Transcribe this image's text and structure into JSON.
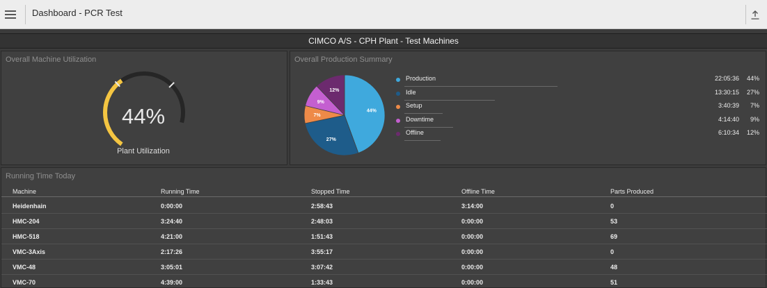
{
  "header": {
    "title": "Dashboard - PCR Test",
    "menu_icon": "hamburger-menu-icon",
    "upload_icon": "upload-icon"
  },
  "banner": {
    "title": "CIMCO A/S - CPH Plant - Test Machines"
  },
  "utilization": {
    "panel_title": "Overall Machine Utilization",
    "value_text": "44%",
    "value": 0.44,
    "label": "Plant Utilization",
    "colors": {
      "fill": "#f4c542",
      "track": "#262626"
    }
  },
  "production": {
    "panel_title": "Overall Production Summary",
    "items": [
      {
        "name": "Production",
        "time": "22:05:36",
        "pct_text": "44%",
        "pct": 44,
        "color": "#3fa9dd"
      },
      {
        "name": "Idle",
        "time": "13:30:15",
        "pct_text": "27%",
        "pct": 27,
        "color": "#1e5c8a"
      },
      {
        "name": "Setup",
        "time": "3:40:39",
        "pct_text": "7%",
        "pct": 7,
        "color": "#ee8a48"
      },
      {
        "name": "Downtime",
        "time": "4:14:40",
        "pct_text": "9%",
        "pct": 9,
        "color": "#c45fd0"
      },
      {
        "name": "Offline",
        "time": "6:10:34",
        "pct_text": "12%",
        "pct": 12,
        "color": "#6c2a6e"
      }
    ]
  },
  "running": {
    "panel_title": "Running Time Today",
    "columns": [
      "Machine",
      "Running Time",
      "Stopped Time",
      "Offline Time",
      "Parts Produced"
    ],
    "rows": [
      [
        "Heidenhain",
        "0:00:00",
        "2:58:43",
        "3:14:00",
        "0"
      ],
      [
        "HMC-204",
        "3:24:40",
        "2:48:03",
        "0:00:00",
        "53"
      ],
      [
        "HMC-518",
        "4:21:00",
        "1:51:43",
        "0:00:00",
        "69"
      ],
      [
        "VMC-3Axis",
        "2:17:26",
        "3:55:17",
        "0:00:00",
        "0"
      ],
      [
        "VMC-48",
        "3:05:01",
        "3:07:42",
        "0:00:00",
        "48"
      ],
      [
        "VMC-70",
        "4:39:00",
        "1:33:43",
        "0:00:00",
        "51"
      ]
    ]
  }
}
